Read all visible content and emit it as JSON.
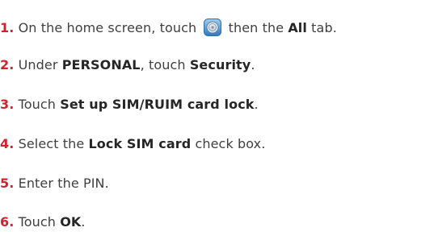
{
  "steps": [
    {
      "number": "1.",
      "part1": " On the home screen, touch ",
      "icon": "settings-gear-icon",
      "part2": " then the ",
      "bold1": "All",
      "part3": " tab."
    },
    {
      "number": "2.",
      "part1": " Under ",
      "bold1": "PERSONAL",
      "part2": ", touch ",
      "bold2": "Security",
      "part3": "."
    },
    {
      "number": "3.",
      "part1": " Touch ",
      "bold1": "Set up SIM/RUIM card lock",
      "part2": "."
    },
    {
      "number": "4.",
      "part1": " Select the ",
      "bold1": "Lock SIM card",
      "part2": " check box."
    },
    {
      "number": "5.",
      "part1": " Enter the PIN."
    },
    {
      "number": "6.",
      "part1": " Touch ",
      "bold1": "OK",
      "part2": "."
    }
  ],
  "colors": {
    "step_number": "#d4202c",
    "text": "#3f3f3f",
    "bold_text": "#262626",
    "icon_ring": "#3a8fd6"
  }
}
